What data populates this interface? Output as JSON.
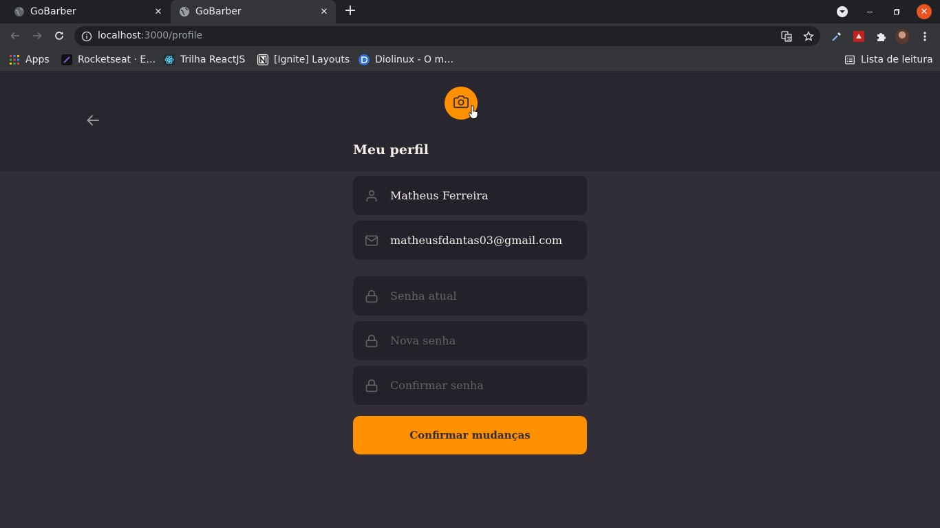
{
  "browser": {
    "tabs": [
      {
        "title": "GoBarber",
        "active": false
      },
      {
        "title": "GoBarber",
        "active": true
      }
    ],
    "url_host": "localhost",
    "url_path": ":3000/profile",
    "bookmarks": [
      {
        "label": "Apps",
        "icon": "apps-grid-icon"
      },
      {
        "label": "Rocketseat · E…",
        "icon": "rocketseat-icon"
      },
      {
        "label": "Trilha ReactJS",
        "icon": "react-icon"
      },
      {
        "label": "[Ignite] Layouts",
        "icon": "notion-icon"
      },
      {
        "label": "Diolinux - O m…",
        "icon": "diolinux-icon"
      }
    ],
    "reading_list": "Lista de leitura"
  },
  "profile": {
    "title": "Meu perfil",
    "name": "Matheus Ferreira",
    "email": "matheusfdantas03@gmail.com",
    "current_password_placeholder": "Senha atual",
    "new_password_placeholder": "Nova senha",
    "confirm_password_placeholder": "Confirmar senha",
    "submit_label": "Confirmar mudanças"
  },
  "colors": {
    "accent": "#ff9000",
    "background": "#312e38",
    "header": "#28262e",
    "input": "#232129",
    "text": "#f4ede8",
    "placeholder": "#666360"
  }
}
